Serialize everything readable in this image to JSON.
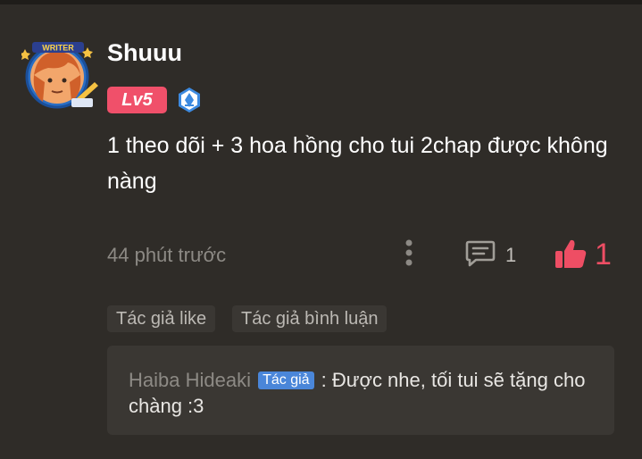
{
  "comment": {
    "username": "Shuuu",
    "avatar_badge_text": "WRITER",
    "level": "Lv5",
    "text": "1 theo dõi + 3 hoa hồng cho tui 2chap được không nàng",
    "timestamp": "44 phút trước",
    "reply_count": "1",
    "like_count": "1"
  },
  "tags": {
    "author_like": "Tác giả like",
    "author_reply": "Tác giả bình luận"
  },
  "reply": {
    "author": "Haiba Hideaki",
    "author_badge": "Tác giả",
    "separator": " : ",
    "text": "Được nhe, tối tui sẽ tặng cho chàng :3"
  },
  "colors": {
    "background": "#2f2c28",
    "level_badge": "#f0506a",
    "like": "#ee4e64",
    "author_badge": "#4a86d9"
  },
  "icons": [
    "writer-frame-avatar",
    "rank-icon",
    "more-vertical-icon",
    "comment-icon",
    "thumbs-up-icon"
  ]
}
